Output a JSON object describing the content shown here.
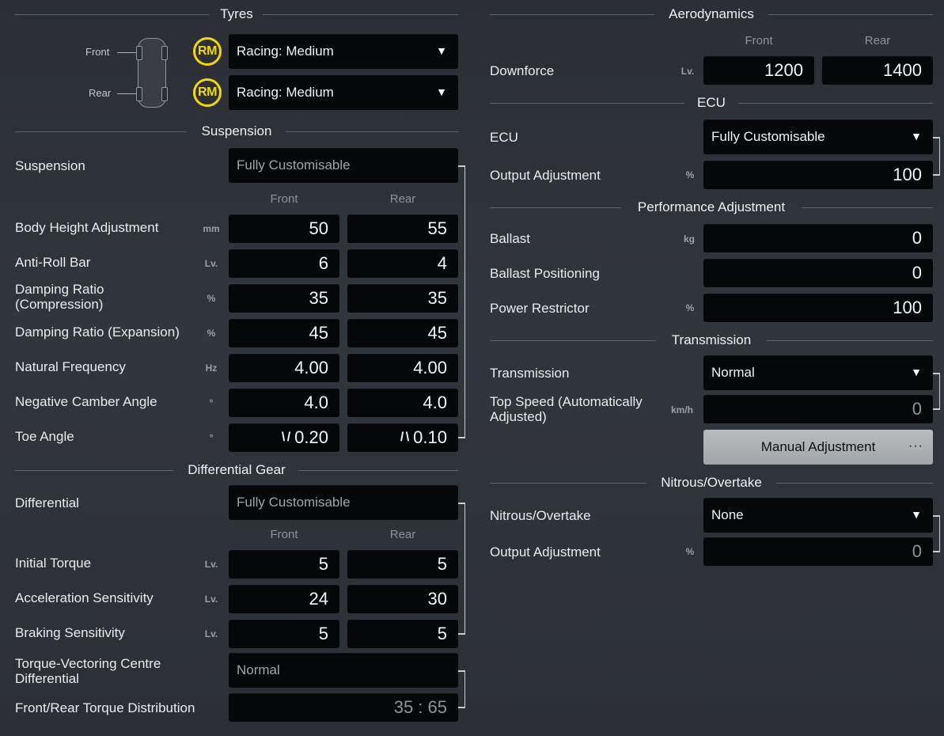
{
  "tyres": {
    "title": "Tyres",
    "front_label": "Front",
    "rear_label": "Rear",
    "front_badge": "RM",
    "rear_badge": "RM",
    "front_compound": "Racing: Medium",
    "rear_compound": "Racing: Medium"
  },
  "suspension": {
    "title": "Suspension",
    "mode_label": "Suspension",
    "mode_value": "Fully Customisable",
    "col_front": "Front",
    "col_rear": "Rear",
    "rows": [
      {
        "label": "Body Height Adjustment",
        "unit": "mm",
        "front": "50",
        "rear": "55"
      },
      {
        "label": "Anti-Roll Bar",
        "unit": "Lv.",
        "front": "6",
        "rear": "4"
      },
      {
        "label": "Damping Ratio\n(Compression)",
        "unit": "%",
        "front": "35",
        "rear": "35"
      },
      {
        "label": "Damping Ratio (Expansion)",
        "unit": "%",
        "front": "45",
        "rear": "45"
      },
      {
        "label": "Natural Frequency",
        "unit": "Hz",
        "front": "4.00",
        "rear": "4.00"
      },
      {
        "label": "Negative Camber Angle",
        "unit": "°",
        "front": "4.0",
        "rear": "4.0"
      },
      {
        "label": "Toe Angle",
        "unit": "°",
        "front": "0.20",
        "rear": "0.10"
      }
    ],
    "toe_front_icon": "\\ /",
    "toe_rear_icon": "/ \\"
  },
  "differential": {
    "title": "Differential Gear",
    "mode_label": "Differential",
    "mode_value": "Fully Customisable",
    "col_front": "Front",
    "col_rear": "Rear",
    "rows": [
      {
        "label": "Initial Torque",
        "unit": "Lv.",
        "front": "5",
        "rear": "5"
      },
      {
        "label": "Acceleration Sensitivity",
        "unit": "Lv.",
        "front": "24",
        "rear": "30"
      },
      {
        "label": "Braking Sensitivity",
        "unit": "Lv.",
        "front": "5",
        "rear": "5"
      }
    ],
    "tvcd_label": "Torque-Vectoring Centre\nDifferential",
    "tvcd_value": "Normal",
    "distribution_label": "Front/Rear Torque Distribution",
    "distribution_value": "35 : 65"
  },
  "aero": {
    "title": "Aerodynamics",
    "col_front": "Front",
    "col_rear": "Rear",
    "downforce_label": "Downforce",
    "downforce_unit": "Lv.",
    "front": "1200",
    "rear": "1400"
  },
  "ecu": {
    "title": "ECU",
    "ecu_label": "ECU",
    "ecu_value": "Fully Customisable",
    "output_label": "Output Adjustment",
    "output_unit": "%",
    "output_value": "100"
  },
  "performance": {
    "title": "Performance Adjustment",
    "ballast_label": "Ballast",
    "ballast_unit": "kg",
    "ballast_value": "0",
    "positioning_label": "Ballast Positioning",
    "positioning_value": "0",
    "restrictor_label": "Power Restrictor",
    "restrictor_unit": "%",
    "restrictor_value": "100"
  },
  "transmission": {
    "title": "Transmission",
    "trans_label": "Transmission",
    "trans_value": "Normal",
    "top_speed_label": "Top Speed (Automatically\nAdjusted)",
    "top_speed_unit": "km/h",
    "top_speed_value": "0",
    "manual_button": "Manual Adjustment",
    "manual_dots": "···"
  },
  "nitrous": {
    "title": "Nitrous/Overtake",
    "label": "Nitrous/Overtake",
    "value": "None",
    "output_label": "Output Adjustment",
    "output_unit": "%",
    "output_value": "0"
  },
  "icons": {
    "dropdown_arrow": "▼"
  }
}
